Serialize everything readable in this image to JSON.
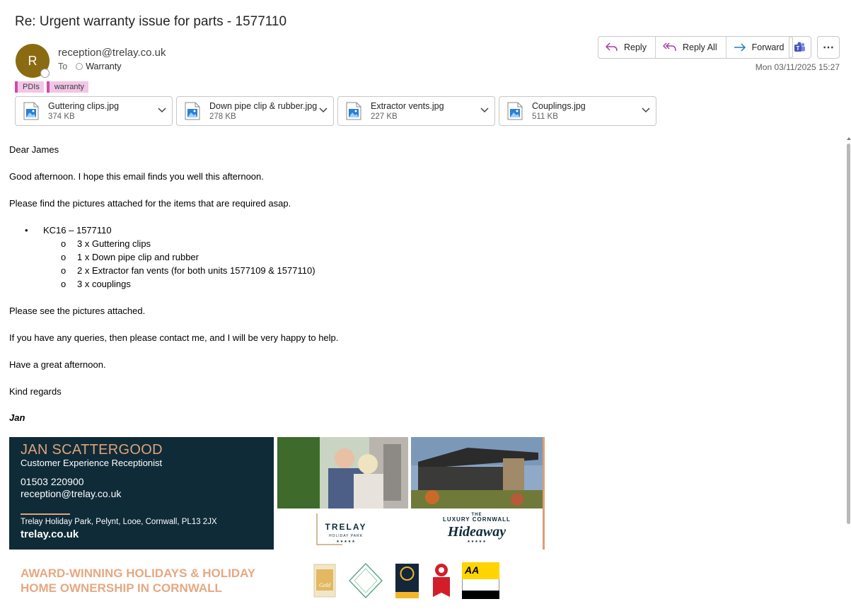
{
  "subject": "Re: Urgent warranty issue for parts - 1577110",
  "sender": {
    "initial": "R",
    "email": "reception@trelay.co.uk"
  },
  "to": {
    "label": "To",
    "recipient": "Warranty"
  },
  "tags": [
    {
      "label": "PDIs"
    },
    {
      "label": "warranty"
    }
  ],
  "actions": {
    "reply": "Reply",
    "reply_all": "Reply All",
    "forward": "Forward"
  },
  "date": "Mon 03/11/2025 15:27",
  "attachments": [
    {
      "name": "Guttering clips.jpg",
      "size": "374 KB"
    },
    {
      "name": "Down pipe clip & rubber.jpg",
      "size": "278 KB"
    },
    {
      "name": "Extractor vents.jpg",
      "size": "227 KB"
    },
    {
      "name": "Couplings.jpg",
      "size": "511 KB"
    }
  ],
  "body": {
    "greeting": "Dear James",
    "p1": "Good afternoon. I hope this email finds you well this afternoon.",
    "p2": "Please find the pictures attached for the items that are required asap.",
    "bullet": "KC16 – 1577110",
    "sub_items": [
      "3 x Guttering clips",
      "1 x Down pipe clip and rubber",
      "2 x Extractor fan vents (for both units 1577109 & 1577110)",
      "3 x couplings"
    ],
    "p3": "Please see the pictures attached.",
    "p4": "If you have any queries, then please contact me, and I will be very happy to help.",
    "p5": "Have a great afternoon.",
    "closing": "Kind regards",
    "signature": "Jan"
  },
  "sig": {
    "name": "JAN SCATTERGOOD",
    "role": "Customer Experience Receptionist",
    "phone": "01503 220900",
    "email": "reception@trelay.co.uk",
    "address": "Trelay Holiday Park, Pelynt, Looe, Cornwall, PL13 2JX",
    "website": "trelay.co.uk",
    "award_line1": "AWARD-WINNING HOLIDAYS & HOLIDAY",
    "award_line2": "HOME OWNERSHIP IN CORNWALL"
  },
  "colors": {
    "brand_navy": "#0f2b38",
    "brand_peach": "#e0a27c",
    "tag_pink": "#f1c6e6",
    "avatar": "#8b6b12"
  }
}
